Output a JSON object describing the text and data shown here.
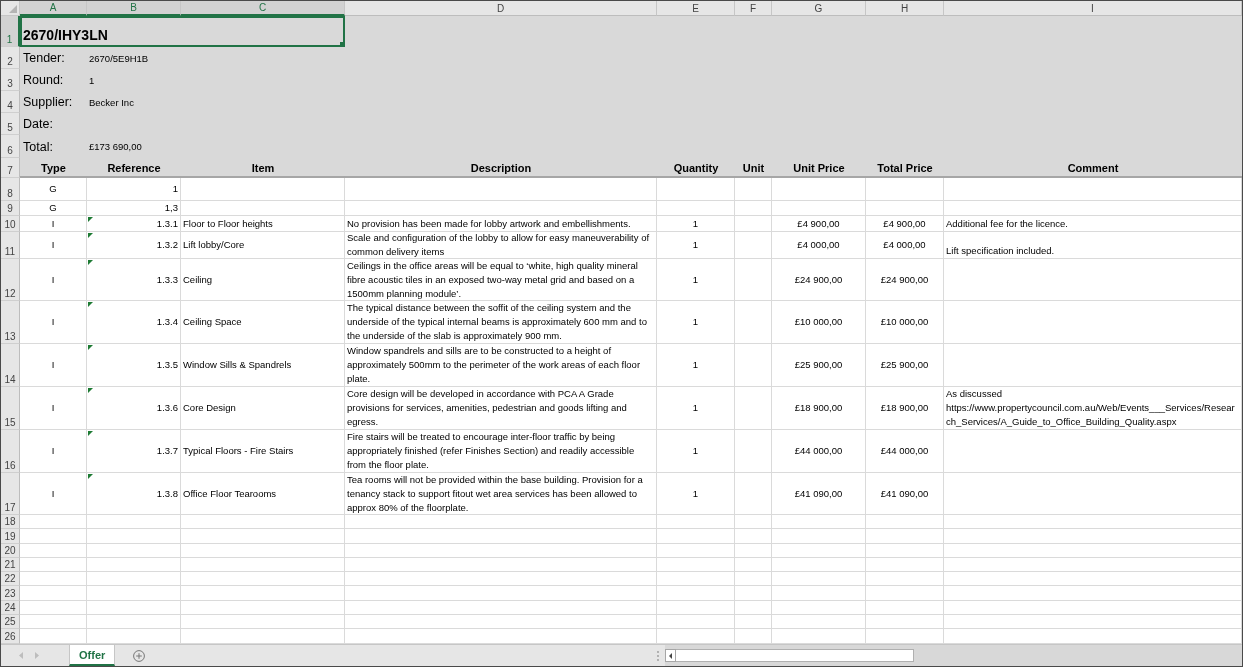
{
  "column_headers": [
    {
      "label": "A",
      "selected": true
    },
    {
      "label": "B",
      "selected": true
    },
    {
      "label": "C",
      "selected": true
    },
    {
      "label": "D",
      "selected": false
    },
    {
      "label": "E",
      "selected": false
    },
    {
      "label": "F",
      "selected": false
    },
    {
      "label": "G",
      "selected": false
    },
    {
      "label": "H",
      "selected": false
    },
    {
      "label": "I",
      "selected": false
    }
  ],
  "row_headers": [
    {
      "label": "1",
      "selected": true
    },
    {
      "label": "2",
      "selected": false
    },
    {
      "label": "3",
      "selected": false
    },
    {
      "label": "4",
      "selected": false
    },
    {
      "label": "5",
      "selected": false
    },
    {
      "label": "6",
      "selected": false
    },
    {
      "label": "7",
      "selected": false
    },
    {
      "label": "8",
      "selected": false
    },
    {
      "label": "9",
      "selected": false
    },
    {
      "label": "10",
      "selected": false
    },
    {
      "label": "11",
      "selected": false
    },
    {
      "label": "12",
      "selected": false
    },
    {
      "label": "13",
      "selected": false
    },
    {
      "label": "14",
      "selected": false
    },
    {
      "label": "15",
      "selected": false
    },
    {
      "label": "16",
      "selected": false
    },
    {
      "label": "17",
      "selected": false
    },
    {
      "label": "18",
      "selected": false
    },
    {
      "label": "19",
      "selected": false
    },
    {
      "label": "20",
      "selected": false
    },
    {
      "label": "21",
      "selected": false
    },
    {
      "label": "22",
      "selected": false
    },
    {
      "label": "23",
      "selected": false
    },
    {
      "label": "24",
      "selected": false
    },
    {
      "label": "25",
      "selected": false
    },
    {
      "label": "26",
      "selected": false
    }
  ],
  "title": {
    "text": "2670/IHY3LN",
    "selected": true
  },
  "fields": [
    {
      "label": "Tender:",
      "value": "2670/5E9H1B"
    },
    {
      "label": "Round:",
      "value": "1"
    },
    {
      "label": "Supplier:",
      "value": "Becker Inc"
    },
    {
      "label": "Date:"
    },
    {
      "label": "Total:",
      "value": "£173 690,00"
    }
  ],
  "table": {
    "columns": [
      "Type",
      "Reference",
      "Item",
      "Description",
      "Quantity",
      "Unit",
      "Unit Price",
      "Total Price",
      "Comment"
    ],
    "rows": [
      {
        "type": "G",
        "reference": "1",
        "flagged": false
      },
      {
        "type": "G",
        "reference": "1,3",
        "flagged": false
      },
      {
        "type": "I",
        "reference": "1.3.1",
        "flagged": true,
        "item": "Floor to Floor heights",
        "description": "No provision has been made for lobby artwork and embellishments.",
        "quantity": "1",
        "unit_price": "£4 900,00",
        "total_price": "£4 900,00",
        "comment": "Additional fee for the licence."
      },
      {
        "type": "I",
        "reference": "1.3.2",
        "flagged": true,
        "item": "Lift lobby/Core",
        "description": "Scale and configuration of the lobby to allow for easy maneuverability of common delivery items",
        "quantity": "1",
        "unit_price": "£4 000,00",
        "total_price": "£4 000,00",
        "comment": "Lift specification included."
      },
      {
        "type": "I",
        "reference": "1.3.3",
        "flagged": true,
        "item": "Ceiling",
        "description": "Ceilings in the office areas will be equal to ‘white, high quality mineral fibre acoustic tiles in an exposed two-way metal grid and based on a 1500mm planning module’.",
        "quantity": "1",
        "unit_price": "£24 900,00",
        "total_price": "£24 900,00"
      },
      {
        "type": "I",
        "reference": "1.3.4",
        "flagged": true,
        "item": "Ceiling Space",
        "description": "The typical distance between the soffit of the ceiling system and the underside of the typical internal beams is approximately 600 mm and to the underside of the slab is approximately 900 mm.",
        "quantity": "1",
        "unit_price": "£10 000,00",
        "total_price": "£10 000,00"
      },
      {
        "type": "I",
        "reference": "1.3.5",
        "flagged": true,
        "item": "Window Sills & Spandrels",
        "description": "Window spandrels and sills are to be constructed to a height of approximately 500mm to the perimeter of the work areas of each floor plate.",
        "quantity": "1",
        "unit_price": "£25 900,00",
        "total_price": "£25 900,00"
      },
      {
        "type": "I",
        "reference": "1.3.6",
        "flagged": true,
        "item": "Core Design",
        "description": "Core design will be developed in accordance with PCA A Grade provisions for services, amenities, pedestrian and goods lifting and egress.",
        "quantity": "1",
        "unit_price": "£18 900,00",
        "total_price": "£18 900,00",
        "comment": "As discussed https://www.propertycouncil.com.au/Web/Events___Services/Research_Services/A_Guide_to_Office_Building_Quality.aspx"
      },
      {
        "type": "I",
        "reference": "1.3.7",
        "flagged": true,
        "item": "Typical Floors - Fire Stairs",
        "description": "Fire stairs will be treated to encourage inter-floor traffic by being appropriately finished (refer Finishes Section) and readily accessible from the floor plate.",
        "quantity": "1",
        "unit_price": "£44 000,00",
        "total_price": "£44 000,00"
      },
      {
        "type": "I",
        "reference": "1.3.8",
        "flagged": true,
        "item": "Office Floor Tearooms",
        "description": "Tea rooms will not be provided within the base building. Provision for a tenancy stack to support fitout wet area services has been allowed to approx 80% of the floorplate.",
        "quantity": "1",
        "unit_price": "£41 090,00",
        "total_price": "£41 090,00"
      }
    ]
  },
  "sheet_nav": [
    {
      "kind": "previous",
      "disabled": true
    },
    {
      "kind": "next",
      "disabled": true
    }
  ],
  "sheet_tabs": [
    {
      "label": "Offer",
      "selected": true
    }
  ]
}
